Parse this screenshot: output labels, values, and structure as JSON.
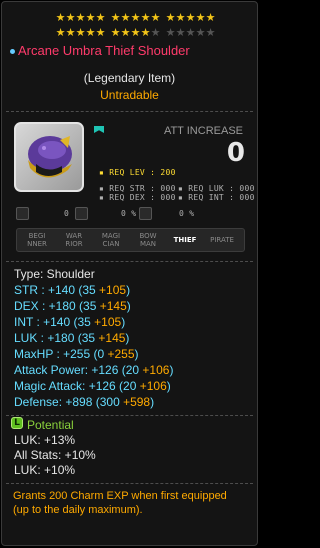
{
  "stars": {
    "row1": [
      true,
      true,
      true,
      true,
      true,
      true,
      true,
      true,
      true,
      true,
      true,
      true,
      true,
      true,
      true
    ],
    "row2": [
      true,
      true,
      true,
      true,
      true,
      true,
      true,
      true,
      true,
      false,
      false,
      false,
      false,
      false,
      false
    ]
  },
  "item": {
    "name": "Arcane Umbra Thief Shoulder",
    "grade": "(Legendary Item)",
    "trade": "Untradable"
  },
  "stat_header": {
    "label": "ATT INCREASE",
    "value": "0"
  },
  "requirements": {
    "lev": "REQ LEV : 200",
    "str": "REQ STR : 000",
    "luk": "REQ LUK : 000",
    "dex": "REQ DEX : 000",
    "int": "REQ INT : 000"
  },
  "small_row": {
    "v1": "0",
    "v2": "0 %",
    "v3": "0 %"
  },
  "jobs": [
    {
      "label": "BEGI\nNNER"
    },
    {
      "label": "WAR\nRIOR"
    },
    {
      "label": "MAGI\nCIAN"
    },
    {
      "label": "BOW\nMAN"
    },
    {
      "label": "THIEF"
    },
    {
      "label": "PIRATE"
    }
  ],
  "stats": {
    "type": "Type: Shoulder",
    "str": {
      "base": "STR : +140 (35 ",
      "bonus": "+105",
      "close": ")"
    },
    "dex": {
      "base": "DEX : +180 (35 ",
      "bonus": "+145",
      "close": ")"
    },
    "int": {
      "base": "INT : +140 (35 ",
      "bonus": "+105",
      "close": ")"
    },
    "luk": {
      "base": "LUK : +180 (35 ",
      "bonus": "+145",
      "close": ")"
    },
    "maxhp": {
      "base": "MaxHP : +255 (0 ",
      "bonus": "+255",
      "close": ")"
    },
    "attack": {
      "base": "Attack Power: +126 (20 ",
      "bonus": "+106",
      "close": ")"
    },
    "magic": {
      "base": "Magic Attack: +126 (20 ",
      "bonus": "+106",
      "close": ")"
    },
    "defense": {
      "base": "Defense: +898 (300 ",
      "bonus": "+598",
      "close": ")"
    }
  },
  "potential": {
    "badge": "L",
    "title": "Potential",
    "lines": [
      "LUK: +13%",
      "All Stats: +10%",
      "LUK: +10%"
    ]
  },
  "footer": {
    "line1": "Grants 200 Charm EXP when first equipped",
    "line2": "(up to the daily maximum)."
  }
}
